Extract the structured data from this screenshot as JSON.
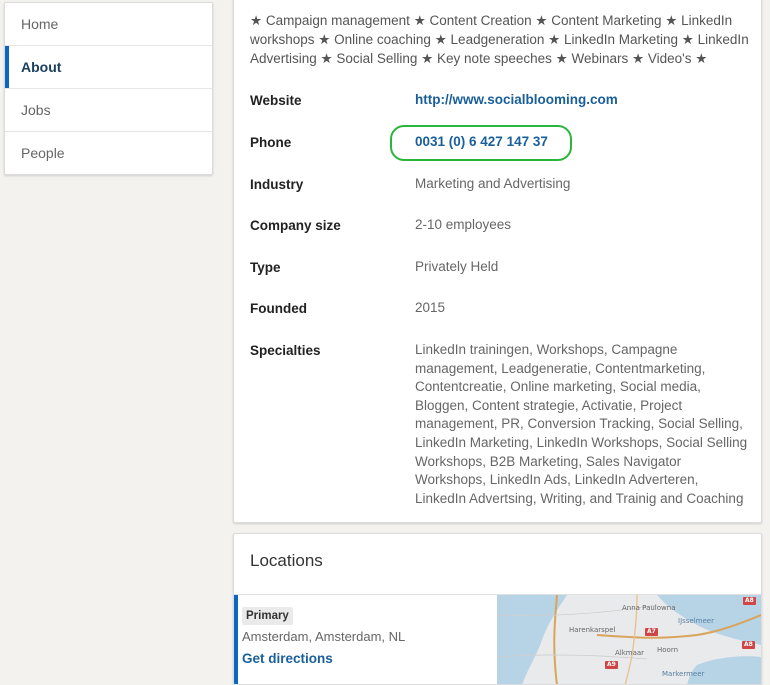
{
  "sidebar": {
    "items": [
      {
        "label": "Home"
      },
      {
        "label": "About"
      },
      {
        "label": "Jobs"
      },
      {
        "label": "People"
      }
    ]
  },
  "about": {
    "description": "★ Campaign management ★ Content Creation ★ Content Marketing ★ LinkedIn workshops ★ Online coaching ★ Leadgeneration ★ LinkedIn Marketing ★ LinkedIn Advertising ★ Social Selling ★ Key note speeches ★ Webinars ★ Video's ★",
    "fields": {
      "website": {
        "label": "Website",
        "value": "http://www.socialblooming.com"
      },
      "phone": {
        "label": "Phone",
        "value": "0031 (0) 6 427 147 37"
      },
      "industry": {
        "label": "Industry",
        "value": "Marketing and Advertising"
      },
      "company_size": {
        "label": "Company size",
        "value": "2-10 employees"
      },
      "type": {
        "label": "Type",
        "value": "Privately Held"
      },
      "founded": {
        "label": "Founded",
        "value": "2015"
      },
      "specialties": {
        "label": "Specialties",
        "value": "LinkedIn trainingen, Workshops, Campagne management, Leadgeneratie, Contentmarketing, Contentcreatie, Online marketing, Social media, Bloggen, Content strategie, Activatie, Project management, PR, Conversion Tracking, Social Selling, LinkedIn Marketing, LinkedIn Workshops, Social Selling Workshops, B2B Marketing, Sales Navigator Workshops, LinkedIn Ads, LinkedIn Adverteren, LinkedIn Advertsing, Writing, and Trainig and Coaching"
      }
    }
  },
  "locations": {
    "title": "Locations",
    "primary_badge": "Primary",
    "address": "Amsterdam, Amsterdam, NL",
    "directions_label": "Get directions",
    "map": {
      "labels": {
        "anna_paulowna": "Anna Paulowna",
        "usselmeer": "IJsselmeer",
        "harenkarspel": "Harenkarspel",
        "alkmaar": "Alkmaar",
        "hoorn": "Hoorn",
        "markermeer": "Markermeer"
      },
      "road_badges": {
        "a8": "A8",
        "a7": "A7",
        "a9": "A9"
      }
    }
  }
}
